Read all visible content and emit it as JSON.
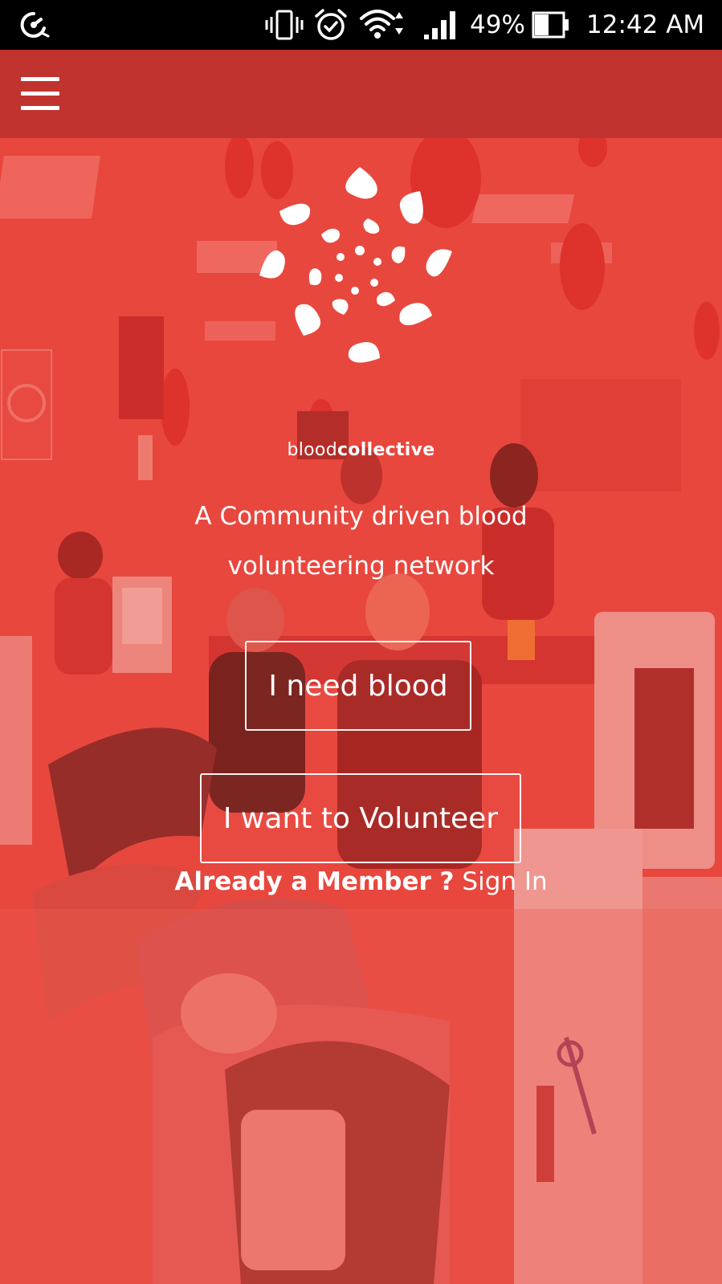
{
  "status_bar": {
    "battery_percent": "49%",
    "battery_level": 0.49,
    "time": "12:42 AM",
    "icons": [
      "sync-icon",
      "vibrate-icon",
      "alarm-icon",
      "wifi-icon",
      "signal-icon",
      "battery-icon"
    ]
  },
  "app_bar": {
    "menu_icon": "hamburger-menu-icon",
    "background_color": "#c1332f"
  },
  "hero": {
    "brand_light": "blood",
    "brand_bold": "collective",
    "tagline": "A Community driven blood volunteering network",
    "need_blood_label": "I need blood",
    "volunteer_label": "I want to Volunteer",
    "member_question": "Already a Member ?",
    "sign_in_label": "Sign In",
    "overlay_color": "#e8473f"
  }
}
